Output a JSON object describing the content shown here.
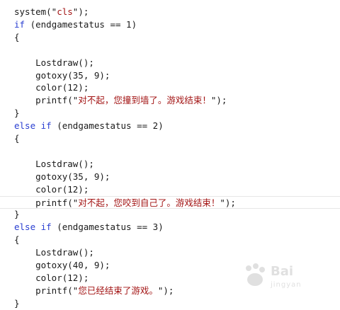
{
  "editor": {
    "lines": [
      {
        "tokens": [
          {
            "t": "system(\"",
            "c": "txt"
          },
          {
            "t": "cls",
            "c": "str"
          },
          {
            "t": "\");",
            "c": "txt"
          }
        ]
      },
      {
        "tokens": [
          {
            "t": "if",
            "c": "kw"
          },
          {
            "t": " (endgamestatus == 1)",
            "c": "txt"
          }
        ]
      },
      {
        "tokens": [
          {
            "t": "{",
            "c": "txt"
          }
        ]
      },
      {
        "tokens": []
      },
      {
        "tokens": [
          {
            "t": "    Lostdraw();",
            "c": "txt"
          }
        ]
      },
      {
        "tokens": [
          {
            "t": "    gotoxy(35, 9);",
            "c": "txt"
          }
        ]
      },
      {
        "tokens": [
          {
            "t": "    color(12);",
            "c": "txt"
          }
        ]
      },
      {
        "tokens": [
          {
            "t": "    printf(\"",
            "c": "txt"
          },
          {
            "t": "对不起，您撞到墙了。游戏结束！",
            "c": "str"
          },
          {
            "t": "\");",
            "c": "txt"
          }
        ]
      },
      {
        "tokens": [
          {
            "t": "}",
            "c": "txt"
          }
        ]
      },
      {
        "tokens": [
          {
            "t": "else if",
            "c": "kw"
          },
          {
            "t": " (endgamestatus == 2)",
            "c": "txt"
          }
        ]
      },
      {
        "tokens": [
          {
            "t": "{",
            "c": "txt"
          }
        ]
      },
      {
        "tokens": []
      },
      {
        "tokens": [
          {
            "t": "    Lostdraw();",
            "c": "txt"
          }
        ]
      },
      {
        "tokens": [
          {
            "t": "    gotoxy(35, 9);",
            "c": "txt"
          }
        ]
      },
      {
        "tokens": [
          {
            "t": "    color(12);",
            "c": "txt"
          }
        ]
      },
      {
        "tokens": [
          {
            "t": "    printf(\"",
            "c": "txt"
          },
          {
            "t": "对不起，您咬到自己了。游戏结束！",
            "c": "str"
          },
          {
            "t": "\");",
            "c": "txt"
          }
        ],
        "current": true
      },
      {
        "tokens": [
          {
            "t": "}",
            "c": "txt"
          }
        ]
      },
      {
        "tokens": [
          {
            "t": "else if",
            "c": "kw"
          },
          {
            "t": " (endgamestatus == 3)",
            "c": "txt"
          }
        ]
      },
      {
        "tokens": [
          {
            "t": "{",
            "c": "txt"
          }
        ]
      },
      {
        "tokens": [
          {
            "t": "    Lostdraw();",
            "c": "txt"
          }
        ]
      },
      {
        "tokens": [
          {
            "t": "    gotoxy(40, 9);",
            "c": "txt"
          }
        ]
      },
      {
        "tokens": [
          {
            "t": "    color(12);",
            "c": "txt"
          }
        ]
      },
      {
        "tokens": [
          {
            "t": "    printf(\"",
            "c": "txt"
          },
          {
            "t": "您已经结束了游戏。",
            "c": "str"
          },
          {
            "t": "\");",
            "c": "txt"
          }
        ]
      },
      {
        "tokens": [
          {
            "t": "}",
            "c": "txt"
          }
        ]
      }
    ]
  },
  "watermark": {
    "brand": "Bai",
    "sub": "jingyan"
  },
  "colors": {
    "keyword": "#2a3fd1",
    "string": "#a31515",
    "text": "#1a1a1a"
  }
}
